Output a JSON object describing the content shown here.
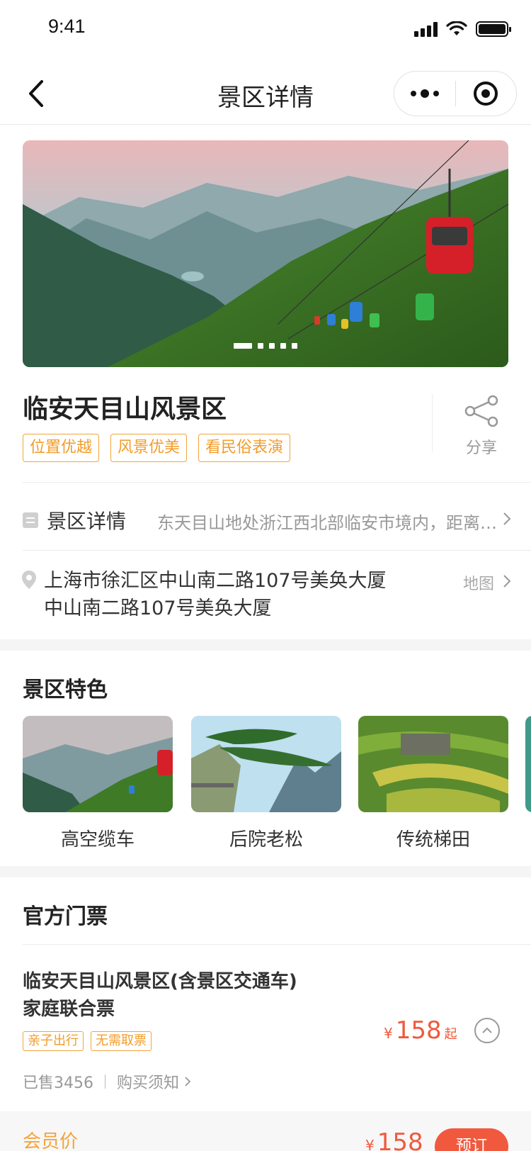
{
  "status_bar": {
    "time": "9:41"
  },
  "nav": {
    "title": "景区详情"
  },
  "banner": {
    "slide_count": 5,
    "active_index": 0
  },
  "scenic": {
    "name": "临安天目山风景区",
    "tags": [
      "位置优越",
      "风景优美",
      "看民俗表演"
    ],
    "share_label": "分享"
  },
  "detail_row": {
    "label": "景区详情",
    "description": "东天目山地处浙江西北部临安市境内，距离杭州市区约…"
  },
  "address": {
    "line1": "上海市徐汇区中山南二路107号美奂大厦",
    "line2": "中山南二路107号美奂大厦",
    "map_label": "地图"
  },
  "features": {
    "title": "景区特色",
    "items": [
      {
        "name": "高空缆车"
      },
      {
        "name": "后院老松"
      },
      {
        "name": "传统梯田"
      }
    ]
  },
  "tickets": {
    "title": "官方门票",
    "item": {
      "name_line1": "临安天目山风景区(含景区交通车)",
      "name_line2": "家庭联合票",
      "tags": [
        "亲子出行",
        "无需取票"
      ],
      "currency": "¥",
      "price": "158",
      "price_suffix": "起",
      "sold": "已售3456",
      "notice": "购买须知"
    },
    "member": {
      "label": "会员价",
      "currency": "¥",
      "price": "158",
      "button": "预订"
    }
  },
  "colors": {
    "accent": "#f39c28",
    "price": "#f0593e"
  }
}
